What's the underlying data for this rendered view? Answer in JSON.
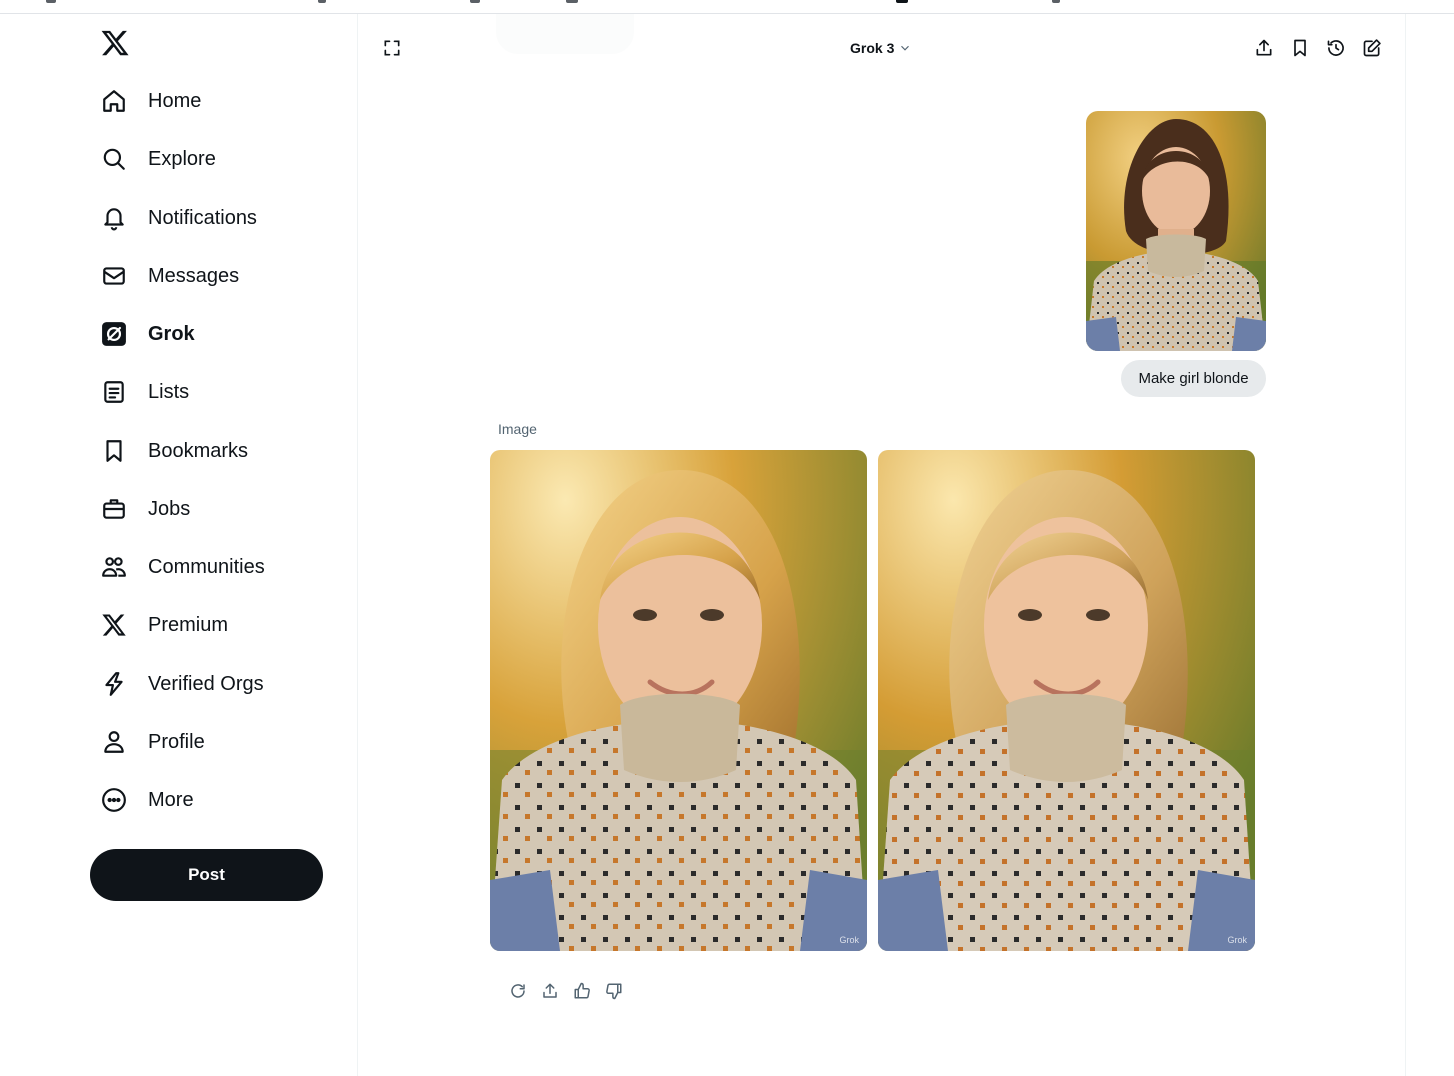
{
  "colors": {
    "text": "#0f1419",
    "muted": "#536471",
    "post_bg": "#0f1419",
    "bubble_bg": "#e7eaec",
    "border": "#eff3f4"
  },
  "sidebar": {
    "logo_icon": "x-logo-icon",
    "items": [
      {
        "label": "Home",
        "icon": "home-icon"
      },
      {
        "label": "Explore",
        "icon": "search-icon"
      },
      {
        "label": "Notifications",
        "icon": "bell-icon"
      },
      {
        "label": "Messages",
        "icon": "mail-icon"
      },
      {
        "label": "Grok",
        "icon": "grok-icon",
        "active": true
      },
      {
        "label": "Lists",
        "icon": "list-icon"
      },
      {
        "label": "Bookmarks",
        "icon": "bookmark-icon"
      },
      {
        "label": "Jobs",
        "icon": "briefcase-icon"
      },
      {
        "label": "Communities",
        "icon": "people-icon"
      },
      {
        "label": "Premium",
        "icon": "x-icon"
      },
      {
        "label": "Verified Orgs",
        "icon": "lightning-icon"
      },
      {
        "label": "Profile",
        "icon": "person-icon"
      },
      {
        "label": "More",
        "icon": "more-circle-icon"
      }
    ],
    "post_label": "Post"
  },
  "header": {
    "model": "Grok 3",
    "icons": [
      "expand-icon",
      "share-icon",
      "bookmark-icon",
      "history-icon",
      "new-chat-icon"
    ]
  },
  "chat": {
    "user_message": "Make girl blonde",
    "response_label": "Image",
    "watermark": "Grok",
    "action_icons": [
      "regenerate-icon",
      "share-icon",
      "thumbs-up-icon",
      "thumbs-down-icon"
    ]
  }
}
